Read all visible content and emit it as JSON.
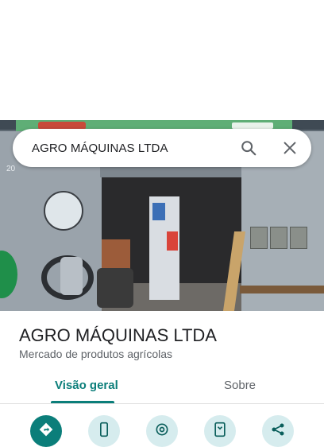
{
  "search": {
    "query": "AGRO MÁQUINAS LTDA"
  },
  "photo": {
    "alt": "storefront photo",
    "house_number": "20"
  },
  "place": {
    "name": "AGRO MÁQUINAS LTDA",
    "category": "Mercado de produtos agrícolas"
  },
  "tabs": [
    {
      "label": "Visão geral",
      "selected": true
    },
    {
      "label": "Sobre",
      "selected": false
    }
  ],
  "actions": [
    {
      "icon": "directions-icon",
      "primary": true
    },
    {
      "icon": "phone-icon",
      "primary": false
    },
    {
      "icon": "website-icon",
      "primary": false
    },
    {
      "icon": "save-icon",
      "primary": false
    },
    {
      "icon": "share-icon",
      "primary": false
    }
  ],
  "colors": {
    "accent": "#0b7e7a",
    "action_bg": "#d6ecee",
    "text_primary": "#202124",
    "text_secondary": "#5f6368"
  }
}
